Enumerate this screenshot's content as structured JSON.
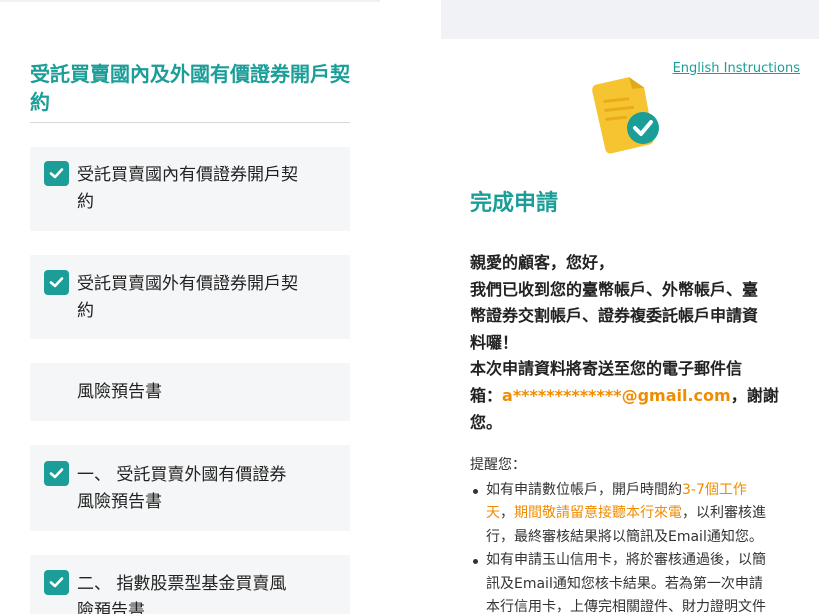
{
  "left": {
    "section_title_line1": "受託買賣國內及外國有價證券開戶契",
    "section_title_line2": "約",
    "items": [
      {
        "label_line1": "受託買賣國內有價證券開戶契",
        "label_line2": "約",
        "checked": true
      },
      {
        "label_line1": "受託買賣國外有價證券開戶契",
        "label_line2": "約",
        "checked": true
      },
      {
        "label_line1": "風險預告書",
        "label_line2": "",
        "checked": false
      },
      {
        "label_line1": "一、 受託買賣外國有價證券",
        "label_line2": "風險預告書",
        "checked": true
      },
      {
        "label_line1": "二、 指數股票型基金買賣風",
        "label_line2": "險預告書",
        "checked": true
      }
    ]
  },
  "right": {
    "english_link": "English Instructions",
    "illustration_icon": "document-check-icon",
    "done_title": "完成申請",
    "message": {
      "line1": "親愛的顧客，您好，",
      "line2": "我們已收到您的臺幣帳戶、外幣帳戶、臺",
      "line3": "幣證券交割帳戶、證券複委託帳戶申請資",
      "line4": "料囉！",
      "line5": "本次申請資料將寄送至您的電子郵件信",
      "line6_prefix": "箱：",
      "email": "a*************@gmail.com",
      "line6_suffix": "，謝謝",
      "line7": "您。"
    },
    "reminder": {
      "heading": "提醒您：",
      "item1_a": "如有申請數位帳戶，開戶時間約",
      "item1_hl1": "3-7個工作",
      "item1_hl1b": "天",
      "item1_b": "，",
      "item1_hl2": "期間敬請留意接聽本行來電",
      "item1_c": "，以利審核進",
      "item1_d": "行，最終審核結果將以簡訊及Email通知您。",
      "item2_a": "如有申請玉山信用卡，將於審核通過後，以簡",
      "item2_b": "訊及Email通知您核卡結果。若為第一次申請",
      "item2_c": "本行信用卡，上傳完相關證件、財力證明文件"
    }
  },
  "colors": {
    "teal": "#1a9e97",
    "orange": "#f08c00",
    "card_bg": "#f5f6f7"
  }
}
